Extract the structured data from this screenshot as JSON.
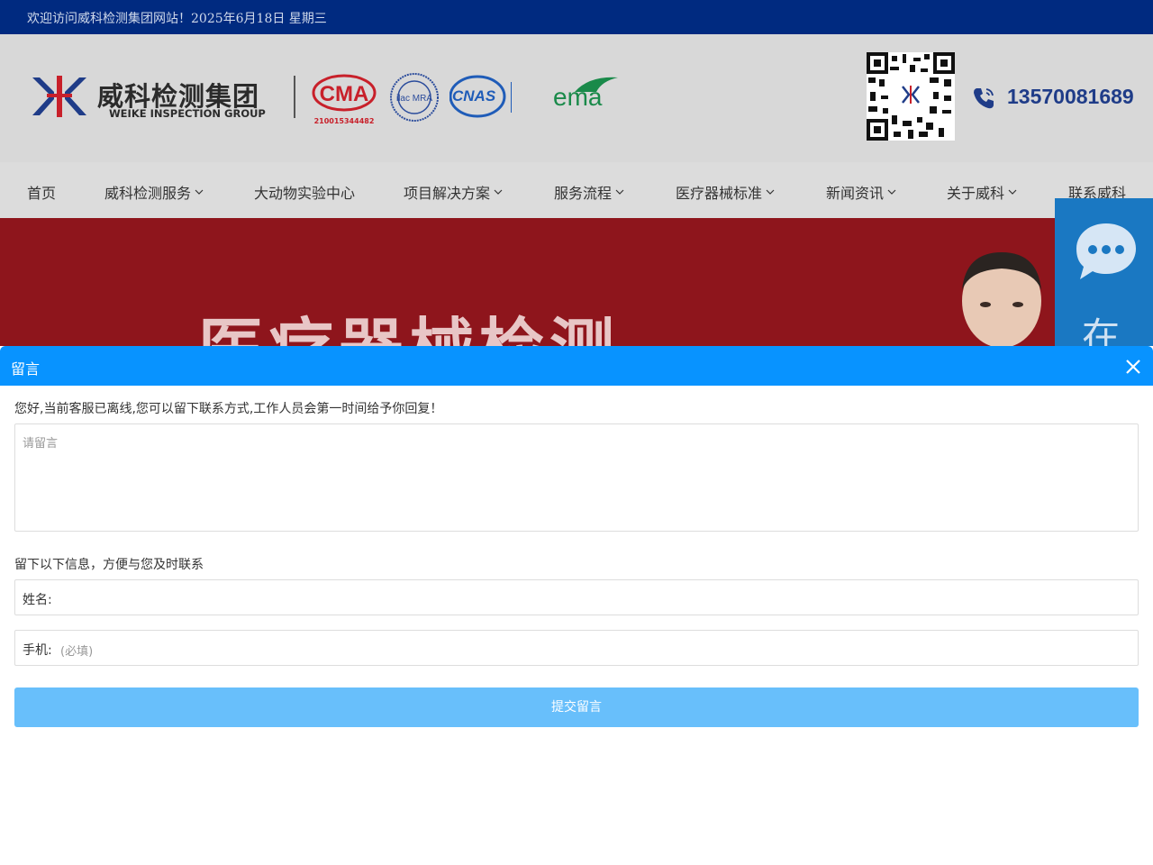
{
  "topbar": {
    "welcome": "欢迎访问威科检测集团网站！2025年6月18日 星期三"
  },
  "header": {
    "logo_cn": "威科检测集团",
    "logo_en": "WEIKE INSPECTION GROUP",
    "cma_number": "210015344482",
    "cnas_label": "CNAS",
    "ema_label": "ema",
    "phone": "13570081689"
  },
  "nav": {
    "items": [
      {
        "label": "首页",
        "dropdown": false
      },
      {
        "label": "威科检测服务",
        "dropdown": true
      },
      {
        "label": "大动物实验中心",
        "dropdown": false
      },
      {
        "label": "项目解决方案",
        "dropdown": true
      },
      {
        "label": "服务流程",
        "dropdown": true
      },
      {
        "label": "医疗器械标准",
        "dropdown": true
      },
      {
        "label": "新闻资讯",
        "dropdown": true
      },
      {
        "label": "关于威科",
        "dropdown": true
      },
      {
        "label": "联系威科",
        "dropdown": false
      }
    ]
  },
  "banner": {
    "title": "医疗器械检测"
  },
  "side_chat": {
    "label": "在"
  },
  "modal": {
    "title": "留言",
    "notice": "您好,当前客服已离线,您可以留下联系方式,工作人员会第一时间给予你回复！",
    "message_placeholder": "请留言",
    "info_text": "留下以下信息，方便与您及时联系",
    "name_label": "姓名:",
    "phone_label": "手机:",
    "phone_placeholder": "(必填)",
    "submit_label": "提交留言"
  },
  "colors": {
    "topbar": "#002a80",
    "modal_header": "#0893ff",
    "submit": "#68bffb",
    "banner": "#8e151c",
    "phone": "#1f3c88"
  }
}
